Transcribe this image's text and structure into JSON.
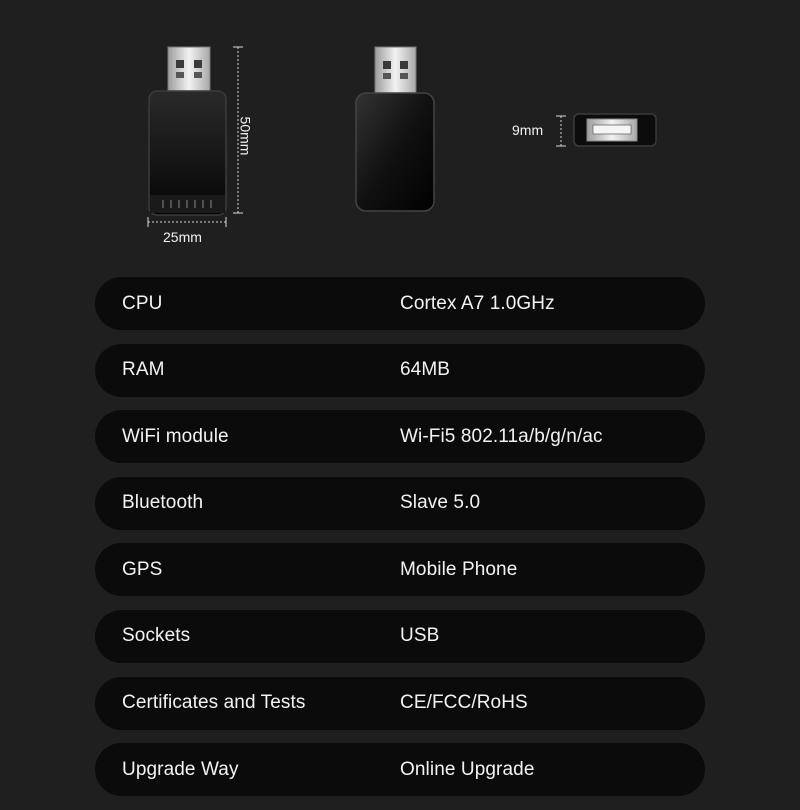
{
  "dimensions": {
    "width_label": "25mm",
    "height_label": "50mm",
    "depth_label": "9mm"
  },
  "specs": [
    {
      "label": "CPU",
      "value": "Cortex A7 1.0GHz"
    },
    {
      "label": "RAM",
      "value": "64MB"
    },
    {
      "label": "WiFi module",
      "value": "Wi-Fi5 802.11a/b/g/n/ac"
    },
    {
      "label": "Bluetooth",
      "value": "Slave 5.0"
    },
    {
      "label": "GPS",
      "value": "Mobile Phone"
    },
    {
      "label": "Sockets",
      "value": "USB"
    },
    {
      "label": "Certificates and Tests",
      "value": "CE/FCC/RoHS"
    },
    {
      "label": "Upgrade Way",
      "value": "Online Upgrade"
    }
  ]
}
